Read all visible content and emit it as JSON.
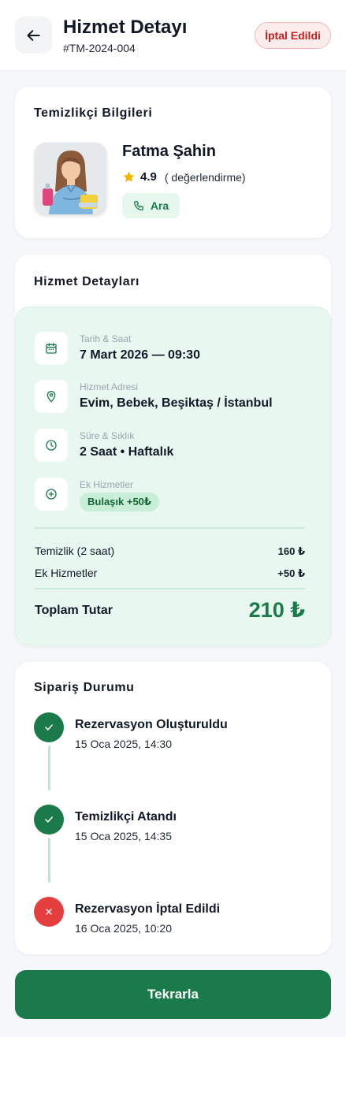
{
  "header": {
    "title": "Hizmet Detayı",
    "order_id": "#TM-2024-004",
    "status": "İptal Edildi",
    "back_icon": "arrow-left-icon"
  },
  "cleaner": {
    "section_title": "Temizlikçi Bilgileri",
    "name": "Fatma Şahin",
    "rating": "4.9",
    "rating_text": "( değerlendirme)",
    "call_label": "Ara"
  },
  "details": {
    "section_title": "Hizmet Detayları",
    "rows": [
      {
        "label": "Tarih & Saat",
        "value": "7 Mart 2026 — 09:30",
        "icon": "calendar-icon"
      },
      {
        "label": "Hizmet Adresi",
        "value": "Evim, Bebek, Beşiktaş / İstanbul",
        "icon": "location-pin-icon"
      },
      {
        "label": "Süre & Sıklık",
        "value": "2 Saat • Haftalık",
        "icon": "clock-icon"
      },
      {
        "label": "Ek Hizmetler",
        "value": "Bulaşık +50₺",
        "icon": "plus-circle-icon"
      }
    ],
    "price_lines": [
      {
        "label": "Temizlik (2 saat)",
        "value": "160 ₺"
      },
      {
        "label": "Ek Hizmetler",
        "value": "+50 ₺"
      }
    ],
    "total_label": "Toplam Tutar",
    "total_value": "210 ₺"
  },
  "timeline": {
    "section_title": "Sipariş Durumu",
    "steps": [
      {
        "title": "Rezervasyon Oluşturuldu",
        "date": "15 Oca 2025, 14:30",
        "state": "done"
      },
      {
        "title": "Temizlikçi Atandı",
        "date": "15 Oca 2025, 14:35",
        "state": "done"
      },
      {
        "title": "Rezervasyon İptal Edildi",
        "date": "16 Oca 2025, 10:20",
        "state": "cancelled"
      }
    ]
  },
  "actions": {
    "repeat_label": "Tekrarla"
  },
  "colors": {
    "primary": "#1a7a4a",
    "cancel": "#e53e3e",
    "star": "#f5b301",
    "detail_bg": "#e8f8f0"
  }
}
